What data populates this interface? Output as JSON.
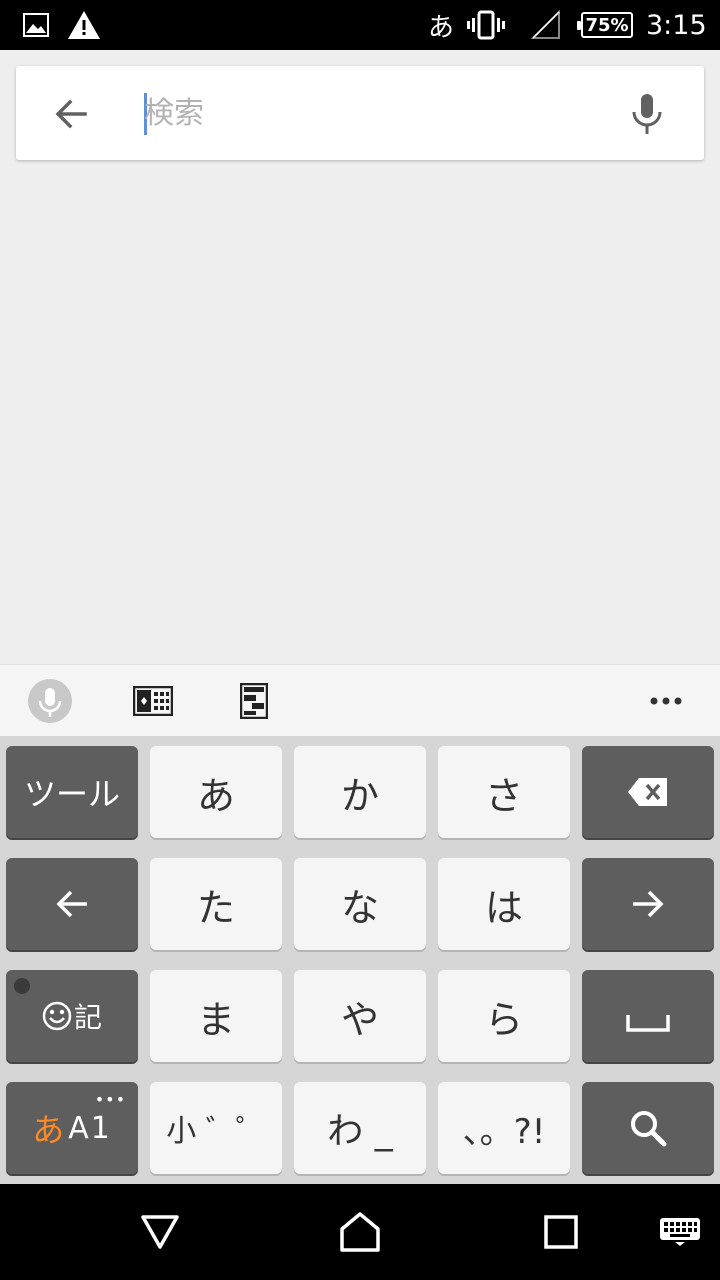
{
  "status_bar": {
    "ime_indicator": "あ",
    "battery": "75%",
    "time": "3:15",
    "icons": [
      "image-icon",
      "warning-icon",
      "vibrate-icon",
      "signal-icon",
      "battery-icon"
    ]
  },
  "search": {
    "placeholder": "検索",
    "value": "",
    "back_icon": "arrow-left-icon",
    "mic_icon": "microphone-icon",
    "caret_color": "#5f8fd9"
  },
  "keyboard_toolbar": {
    "icons": [
      "voice-input-icon",
      "keyboard-switch-icon",
      "clipboard-icon",
      "more-icon"
    ]
  },
  "keyboard": {
    "rows": [
      [
        "ツール",
        "あ",
        "か",
        "さ",
        "backspace"
      ],
      [
        "cursor-left",
        "た",
        "な",
        "は",
        "cursor-right"
      ],
      [
        "emoji-symbol",
        "ま",
        "や",
        "ら",
        "space"
      ],
      [
        "mode-switch",
        "小゛゜",
        "わ_",
        "、。?!",
        "search"
      ]
    ],
    "tool_key": "ツール",
    "key_a": "あ",
    "key_ka": "か",
    "key_sa": "さ",
    "key_ta": "た",
    "key_na": "な",
    "key_ha": "は",
    "key_ma": "ま",
    "key_ya": "や",
    "key_ra": "ら",
    "symbol_key_suffix": "記",
    "mode_key_hira": "あ",
    "mode_key_alnum": "A1",
    "dakuten_key": "小 ゛゜",
    "wa_key": "わ _",
    "punct_key": "、。?!",
    "colors": {
      "light_key": "#f5f5f5",
      "dark_key": "#5e5e5e",
      "accent": "#ff8a1f"
    }
  },
  "nav_bar": {
    "icons": [
      "back-triangle-icon",
      "home-icon",
      "recents-icon",
      "keyboard-icon"
    ]
  }
}
